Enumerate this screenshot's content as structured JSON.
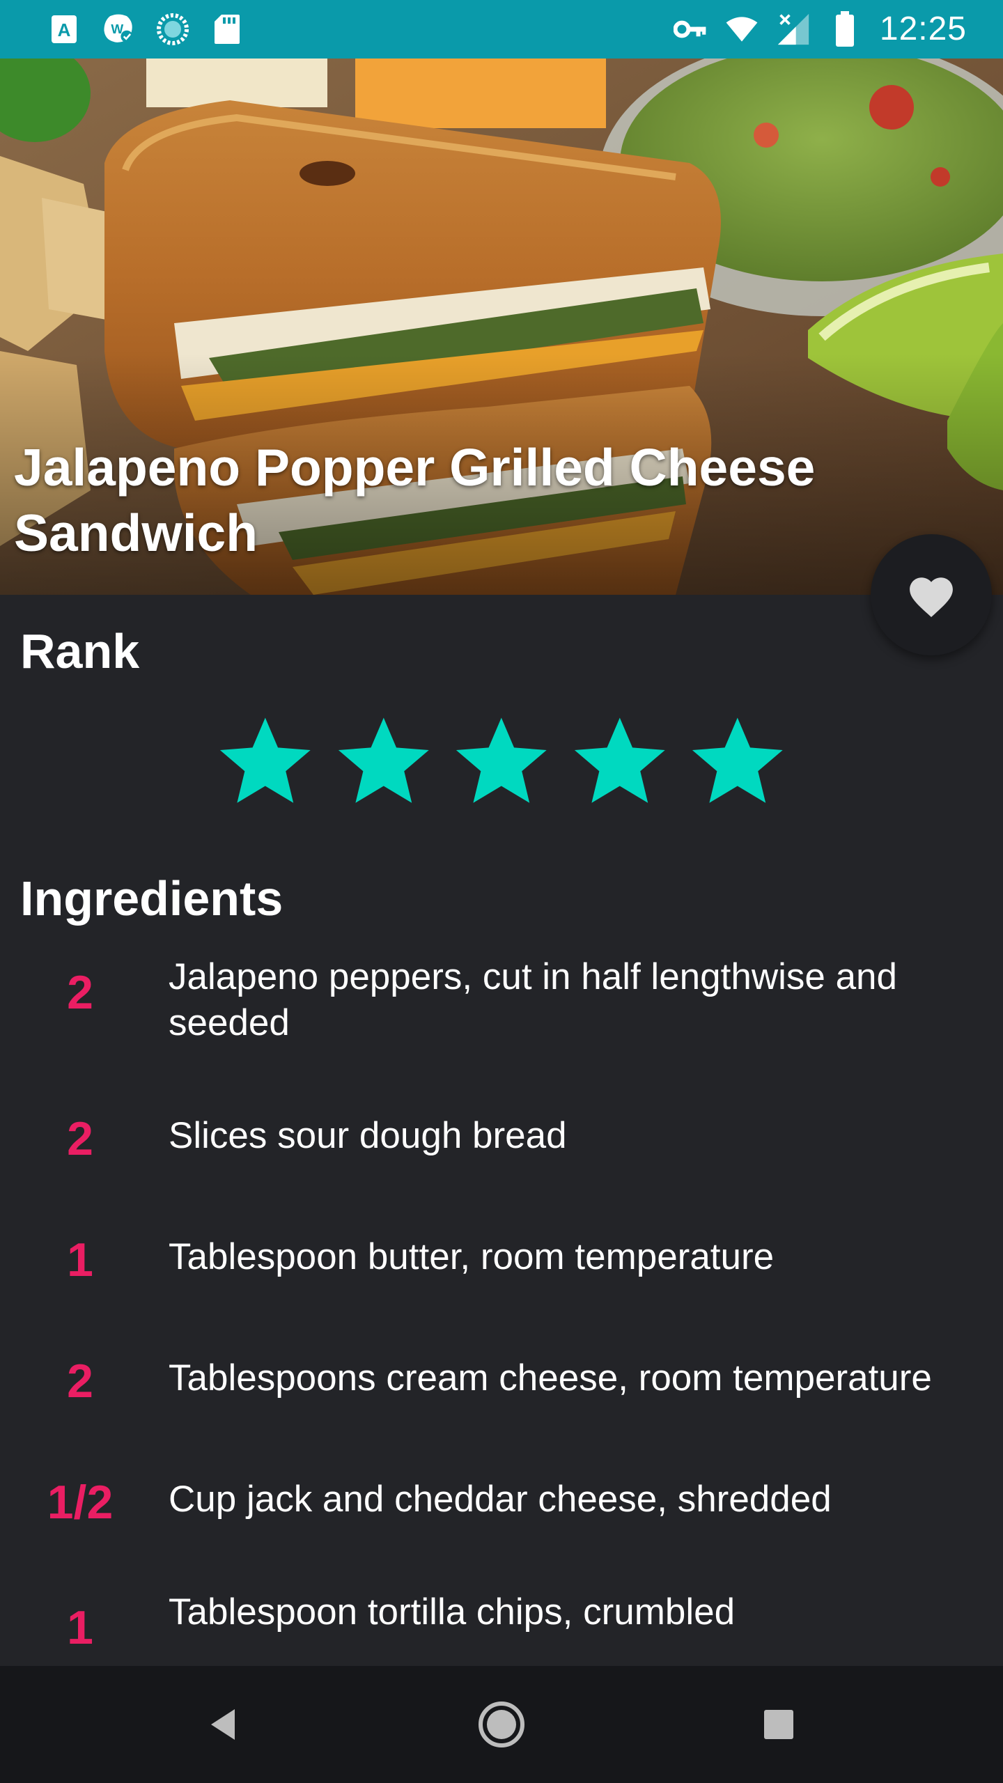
{
  "status_bar": {
    "time": "12:25",
    "left_icons": [
      "a-icon",
      "w-check-icon",
      "sync-circle-icon",
      "sd-card-icon"
    ],
    "right_icons": [
      "vpn-key-icon",
      "wifi-icon",
      "signal-off-icon",
      "battery-icon"
    ],
    "background": "#0a9aaa"
  },
  "recipe": {
    "title": "Jalapeno Popper Grilled Cheese Sandwich",
    "favorite_icon": "heart-icon"
  },
  "rank": {
    "label": "Rank",
    "rating": 5,
    "max": 5,
    "star_color": "#00d9c0"
  },
  "ingredients": {
    "label": "Ingredients",
    "accent_color": "#ea1e63",
    "items": [
      {
        "qty": "2",
        "text": "Jalapeno peppers, cut in half lengthwise and seeded"
      },
      {
        "qty": "2",
        "text": "Slices sour dough bread"
      },
      {
        "qty": "1",
        "text": "Tablespoon butter, room temperature"
      },
      {
        "qty": "2",
        "text": "Tablespoons cream cheese, room temperature"
      },
      {
        "qty": "1/2",
        "text": "Cup jack and cheddar cheese, shredded"
      },
      {
        "qty": "1",
        "text": "Tablespoon tortilla chips, crumbled"
      }
    ]
  },
  "nav_bar": {
    "buttons": [
      "back-icon",
      "home-icon",
      "recents-icon"
    ]
  }
}
